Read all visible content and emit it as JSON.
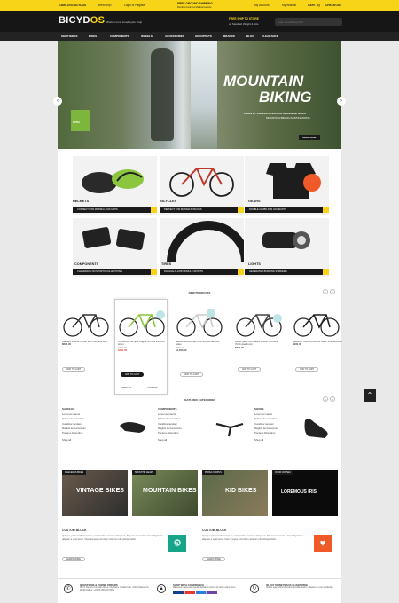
{
  "topbar": {
    "phone": "(1800)-000-BICYDOS",
    "need_help": "Need help?",
    "login": "Login or Register",
    "shipping_title": "FREE GROUND SHIPPING",
    "shipping_sub": "Flexible business Medical service",
    "account": "My Account",
    "wishlist": "My Wishlist",
    "cart": "CART (0)",
    "checkout": "CHECKOUT"
  },
  "header": {
    "logo_a": "BICYD",
    "logo_b": "OS",
    "tagline": "World's most loved cycle shop",
    "promo_title": "FREE SHIP TO STORE",
    "promo_sub": "on Standard Weight & Size",
    "search_placeholder": "Enter search keyword"
  },
  "nav": [
    "SHOP BIKES",
    "BIKES",
    "COMPONENTS",
    "WHEELS",
    "ACCESSORIES",
    "GROUPSETS",
    "BRANDS",
    "BLOG",
    "CLEARANCE"
  ],
  "hero": {
    "title1": "MOUNTAIN",
    "title2": "BIKING",
    "sub": "FROM A LARGEST RANGE OF MOUNTAIN BIKES",
    "sub2": "MOUNTAIN BIKING DESTINATIONS",
    "shop": "SHOP NOW",
    "badge": "HOTEL"
  },
  "cats": [
    {
      "title": "HELMETS",
      "bar": "CONNECT FOR MAXIMA LOOK HOPS",
      "color": "#2a2a2a"
    },
    {
      "title": "BICYCLES",
      "bar": "PERFECT FOR MAXIMA KOSCOAS",
      "color": "#c0392b"
    },
    {
      "title": "GEARS",
      "bar": "DOUBLE CLUBS FOR HOUSIATOS",
      "color": "#222"
    },
    {
      "title": "COMPONENTS",
      "bar": "CLEARANCE ON SPORTS COLLECTIONS",
      "color": "#333"
    },
    {
      "title": "TIRES",
      "bar": "FRAGILE ALLOW MODULE SPORTS",
      "color": "#1a1a1a"
    },
    {
      "title": "LIGHTS",
      "bar": "GENERATED BONDING STRIKEMA",
      "color": "#333"
    }
  ],
  "new_products": {
    "title": "NEW PRODUCTS",
    "items": [
      {
        "name": "Saddles Invena further kiwi Interplus item",
        "price": "$600.00"
      },
      {
        "name": "Consectus de quis magna nim adi vivat do lorem",
        "price_old": "$350.00",
        "price_new": "$300.00",
        "add": "ADD TO CART",
        "wish": "WISHLIST",
        "compare": "COMPARE"
      },
      {
        "name": "Sedius fashion harm cut tostra Interplus sales",
        "price_old": "$500.00",
        "price_new": "$1,000.00"
      },
      {
        "name": "Dimer glath thin balled strudio hot deck (Tech-pavilions)",
        "price": "$872.00"
      },
      {
        "name": "Sidequer miclo consumer done Smolder/fuse",
        "price": "$900.00"
      }
    ],
    "add": "ADD TO CART"
  },
  "featured": {
    "title": "FEATURED CATEGORIES",
    "cols": [
      {
        "title": "SADDLES",
        "items": [
          "Loremus mauris",
          "Nullam do sumothes",
          "Curabitur iaculam",
          "Magbis do haroculum",
          "Pocamo bibendum"
        ],
        "shop": "Shop all"
      },
      {
        "title": "COMPONENTS",
        "items": [
          "Loremus mauris",
          "Nullam do sumothes",
          "Curabitur iaculam",
          "Magbis do haroculum",
          "Pocamo bibendum"
        ],
        "shop": "Shop all"
      },
      {
        "title": "SHOES",
        "items": [
          "Loremus mauris",
          "Nullam do sumothes",
          "Curabitur iaculam",
          "Magbis do haroculum",
          "Pocamo bibendum"
        ],
        "shop": "Shop all"
      }
    ]
  },
  "banners": [
    {
      "tag": "MAECENAS BIKES",
      "title": "VINTAGE BIKES"
    },
    {
      "tag": "SMOOTHE GEARS",
      "title": "MOUNTAIN BIKES"
    },
    {
      "tag": "PERSA CORPUS",
      "title": "KID BIKES"
    },
    {
      "tag": "FORM CONSEC",
      "title": "LOREMOUS IRIS"
    }
  ],
  "blocks": [
    {
      "title": "CUSTOM BLOCK",
      "text": "Quisque placerat libero lorem, sed interdum massa volutpat at. Aliquam in mauris a lacus dignissim aliquam a post lorem. Nam tempus, nisl ullam reiternm elit volutpat dolor.",
      "btn": "LEARN MORE"
    },
    {
      "title": "CUSTOM BLOCK",
      "text": "Quisque placerat libero lorem, sed interdum massa volutpat at. Aliquam in mauris a lacus dignissim aliquam a post lorem. Nam tempus, nisl ullam reiternm elit volutpat dolor.",
      "btn": "LEARN MORE"
    }
  ],
  "footer": [
    {
      "title": "QUESTIONS & PHONE ORDERS",
      "text": "000 S. Reverso Fountain Street, City Name, Postal Code, United States, CA 90000 Call us: +1(000)-000-BICYDOS"
    },
    {
      "title": "SHOP WITH CONFIDENCE",
      "text": "Maecenas ulama ante ligulas dasbaros conctus at varius edum lorem"
    },
    {
      "title": "30 DAY MONEYBACK GUARANTEE",
      "text": "Nullum agentullum bibendum gravidat toriorm. Aliquam ac ente vestibulum"
    }
  ],
  "colors": {
    "accent": "#f7d417",
    "teal": "#16a589",
    "orange": "#f05a28"
  }
}
